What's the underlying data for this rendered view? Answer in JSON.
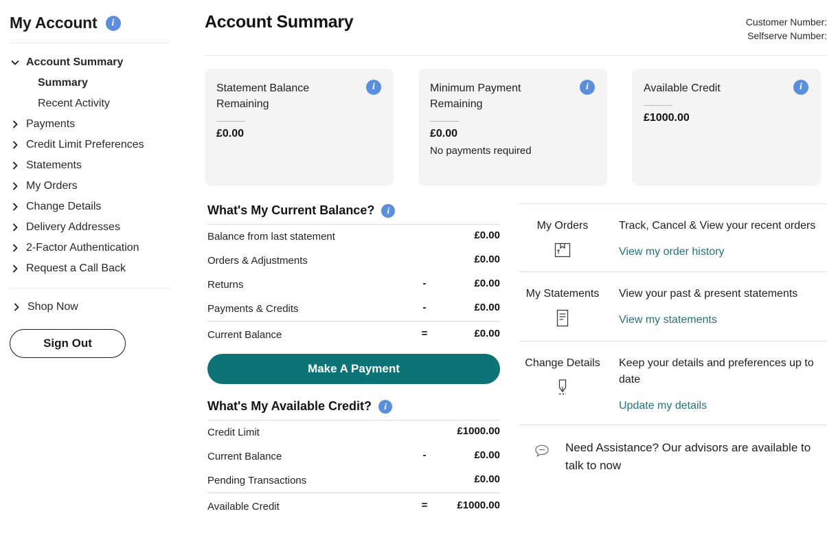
{
  "sidebar": {
    "title": "My Account",
    "info_icon": "info-icon",
    "nav": [
      {
        "label": "Account Summary",
        "bold": true,
        "chevron": "chevron-down-icon",
        "indent": false
      },
      {
        "label": "Summary",
        "bold": true,
        "chevron": "none",
        "indent": true
      },
      {
        "label": "Recent Activity",
        "bold": false,
        "chevron": "none",
        "indent": true
      },
      {
        "label": "Payments",
        "bold": false,
        "chevron": "chevron-right-icon",
        "indent": false
      },
      {
        "label": "Credit Limit Preferences",
        "bold": false,
        "chevron": "chevron-right-icon",
        "indent": false
      },
      {
        "label": "Statements",
        "bold": false,
        "chevron": "chevron-right-icon",
        "indent": false
      },
      {
        "label": "My Orders",
        "bold": false,
        "chevron": "chevron-right-icon",
        "indent": false
      },
      {
        "label": "Change Details",
        "bold": false,
        "chevron": "chevron-right-icon",
        "indent": false
      },
      {
        "label": "Delivery Addresses",
        "bold": false,
        "chevron": "chevron-right-icon",
        "indent": false
      },
      {
        "label": "2-Factor Authentication",
        "bold": false,
        "chevron": "chevron-right-icon",
        "indent": false
      },
      {
        "label": "Request a Call Back",
        "bold": false,
        "chevron": "chevron-right-icon",
        "indent": false
      }
    ],
    "shop_now": "Shop Now",
    "sign_out": "Sign Out"
  },
  "header": {
    "title": "Account Summary",
    "customer_number_label": "Customer Number:",
    "customer_number_value": "",
    "selfserve_number_label": "Selfserve Number:",
    "selfserve_number_value": ""
  },
  "cards": [
    {
      "title": "Statement Balance Remaining",
      "amount": "£0.00",
      "note": ""
    },
    {
      "title": "Minimum Payment Remaining",
      "amount": "£0.00",
      "note": "No payments required"
    },
    {
      "title": "Available Credit",
      "amount": "£1000.00",
      "note": ""
    }
  ],
  "current_balance": {
    "heading": "What's My Current Balance?",
    "rows": [
      {
        "label": "Balance from last statement",
        "op": "",
        "amount": "£0.00"
      },
      {
        "label": "Orders & Adjustments",
        "op": "",
        "amount": "£0.00"
      },
      {
        "label": "Returns",
        "op": "-",
        "amount": "£0.00"
      },
      {
        "label": "Payments & Credits",
        "op": "-",
        "amount": "£0.00"
      }
    ],
    "total": {
      "label": "Current Balance",
      "op": "=",
      "amount": "£0.00"
    },
    "button": "Make A Payment"
  },
  "available_credit": {
    "heading": "What's My Available Credit?",
    "rows": [
      {
        "label": "Credit Limit",
        "op": "",
        "amount": "£1000.00"
      },
      {
        "label": "Current Balance",
        "op": "-",
        "amount": "£0.00"
      },
      {
        "label": "Pending Transactions",
        "op": "",
        "amount": "£0.00"
      }
    ],
    "total": {
      "label": "Available Credit",
      "op": "=",
      "amount": "£1000.00"
    }
  },
  "panel": {
    "rows": [
      {
        "title": "My Orders",
        "icon": "package-box-icon",
        "desc": "Track, Cancel & View your recent orders",
        "link": "View my order history"
      },
      {
        "title": "My Statements",
        "icon": "document-lines-icon",
        "desc": "View your past & present statements",
        "link": "View my statements"
      },
      {
        "title": "Change Details",
        "icon": "pen-nib-icon",
        "desc": "Keep your details and preferences up to date",
        "link": "Update my details"
      }
    ],
    "assistance": {
      "icon": "chat-bubble-icon",
      "text": "Need Assistance? Our advisors are available to talk to now"
    }
  },
  "colors": {
    "accent_teal": "#0d7377",
    "link_teal": "#257374",
    "info_blue": "#5b8fdb",
    "card_bg": "#f4f4f4"
  }
}
